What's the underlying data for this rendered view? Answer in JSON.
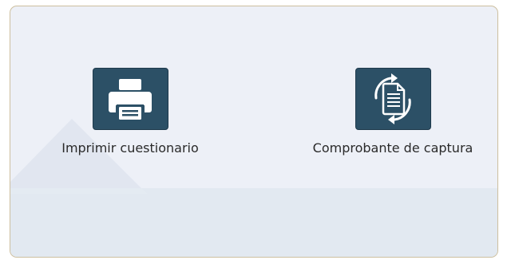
{
  "actions": {
    "print_questionnaire": {
      "label": "Imprimir cuestionario",
      "icon": "printer-icon"
    },
    "capture_receipt": {
      "label": "Comprobante de captura",
      "icon": "document-sync-icon"
    }
  },
  "colors": {
    "tile_background": "#2c5066",
    "panel_background": "#edf0f7",
    "panel_border": "#cdbf9f",
    "icon": "#ffffff",
    "label_text": "#2a2a2a"
  }
}
